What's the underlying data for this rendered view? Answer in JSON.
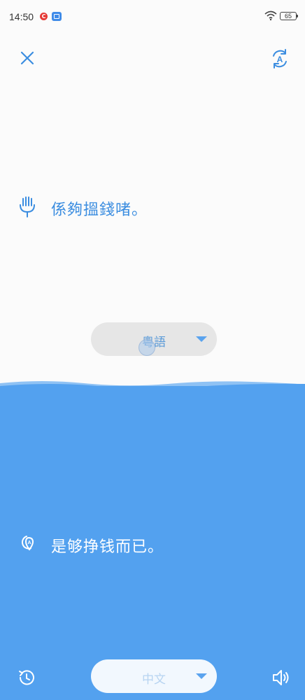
{
  "status": {
    "time": "14:50",
    "app1_glyph": "C",
    "battery": "65",
    "icons": [
      "wifi-icon",
      "battery-icon"
    ]
  },
  "header": {
    "close_icon": "close-icon",
    "switch_icon": "auto-translate-icon"
  },
  "source": {
    "icon": "microphone-icon",
    "text": "係夠搵錢啫。",
    "language": "粵語"
  },
  "target": {
    "icon": "speaker-recognition-icon",
    "text": "是够挣钱而已。",
    "language": "中文"
  },
  "footer": {
    "history_icon": "history-icon",
    "volume_icon": "volume-icon"
  },
  "colors": {
    "accent": "#3b8de0",
    "panel": "#53a1ef",
    "background": "#fbfbfb"
  }
}
